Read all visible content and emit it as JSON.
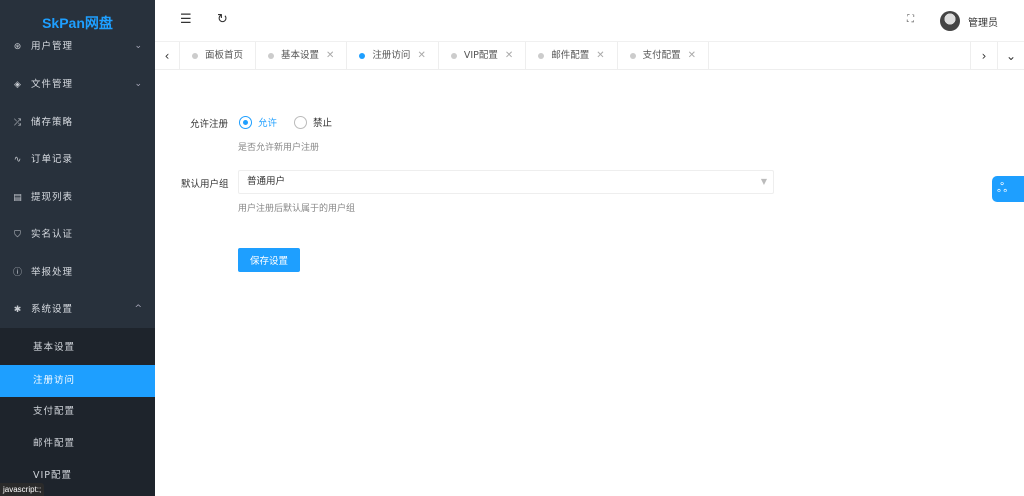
{
  "app": {
    "logo": "SkPan网盘"
  },
  "sidebar": {
    "items": [
      {
        "label": "用户管理",
        "icon": "user-circle-icon",
        "expandable": true
      },
      {
        "label": "文件管理",
        "icon": "layers-icon",
        "expandable": true
      },
      {
        "label": "储存策略",
        "icon": "shuffle-icon"
      },
      {
        "label": "订单记录",
        "icon": "pulse-icon"
      },
      {
        "label": "提现列表",
        "icon": "clipboard-icon"
      },
      {
        "label": "实名认证",
        "icon": "shield-icon"
      },
      {
        "label": "举报处理",
        "icon": "info-icon"
      },
      {
        "label": "系统设置",
        "icon": "gear-icon",
        "expanded": true
      }
    ],
    "sub_items": [
      {
        "label": "基本设置"
      },
      {
        "label": "注册访问",
        "active": true
      },
      {
        "label": "支付配置"
      },
      {
        "label": "邮件配置"
      },
      {
        "label": "VIP配置"
      }
    ]
  },
  "status_bar": "javascript:;",
  "header": {
    "user": "管理员"
  },
  "tabs": [
    {
      "label": "面板首页",
      "closable": false
    },
    {
      "label": "基本设置",
      "closable": true
    },
    {
      "label": "注册访问",
      "closable": true,
      "active": true
    },
    {
      "label": "VIP配置",
      "closable": true
    },
    {
      "label": "邮件配置",
      "closable": true
    },
    {
      "label": "支付配置",
      "closable": true
    }
  ],
  "form": {
    "allow_register": {
      "label": "允许注册",
      "options": [
        "允许",
        "禁止"
      ],
      "selected": "允许",
      "hint": "是否允许新用户注册"
    },
    "default_group": {
      "label": "默认用户组",
      "value": "普通用户",
      "hint": "用户注册后默认属于的用户组"
    },
    "save_label": "保存设置"
  },
  "colors": {
    "accent": "#1e9fff",
    "sidebar": "#28313c",
    "submenu": "#1e242c"
  }
}
